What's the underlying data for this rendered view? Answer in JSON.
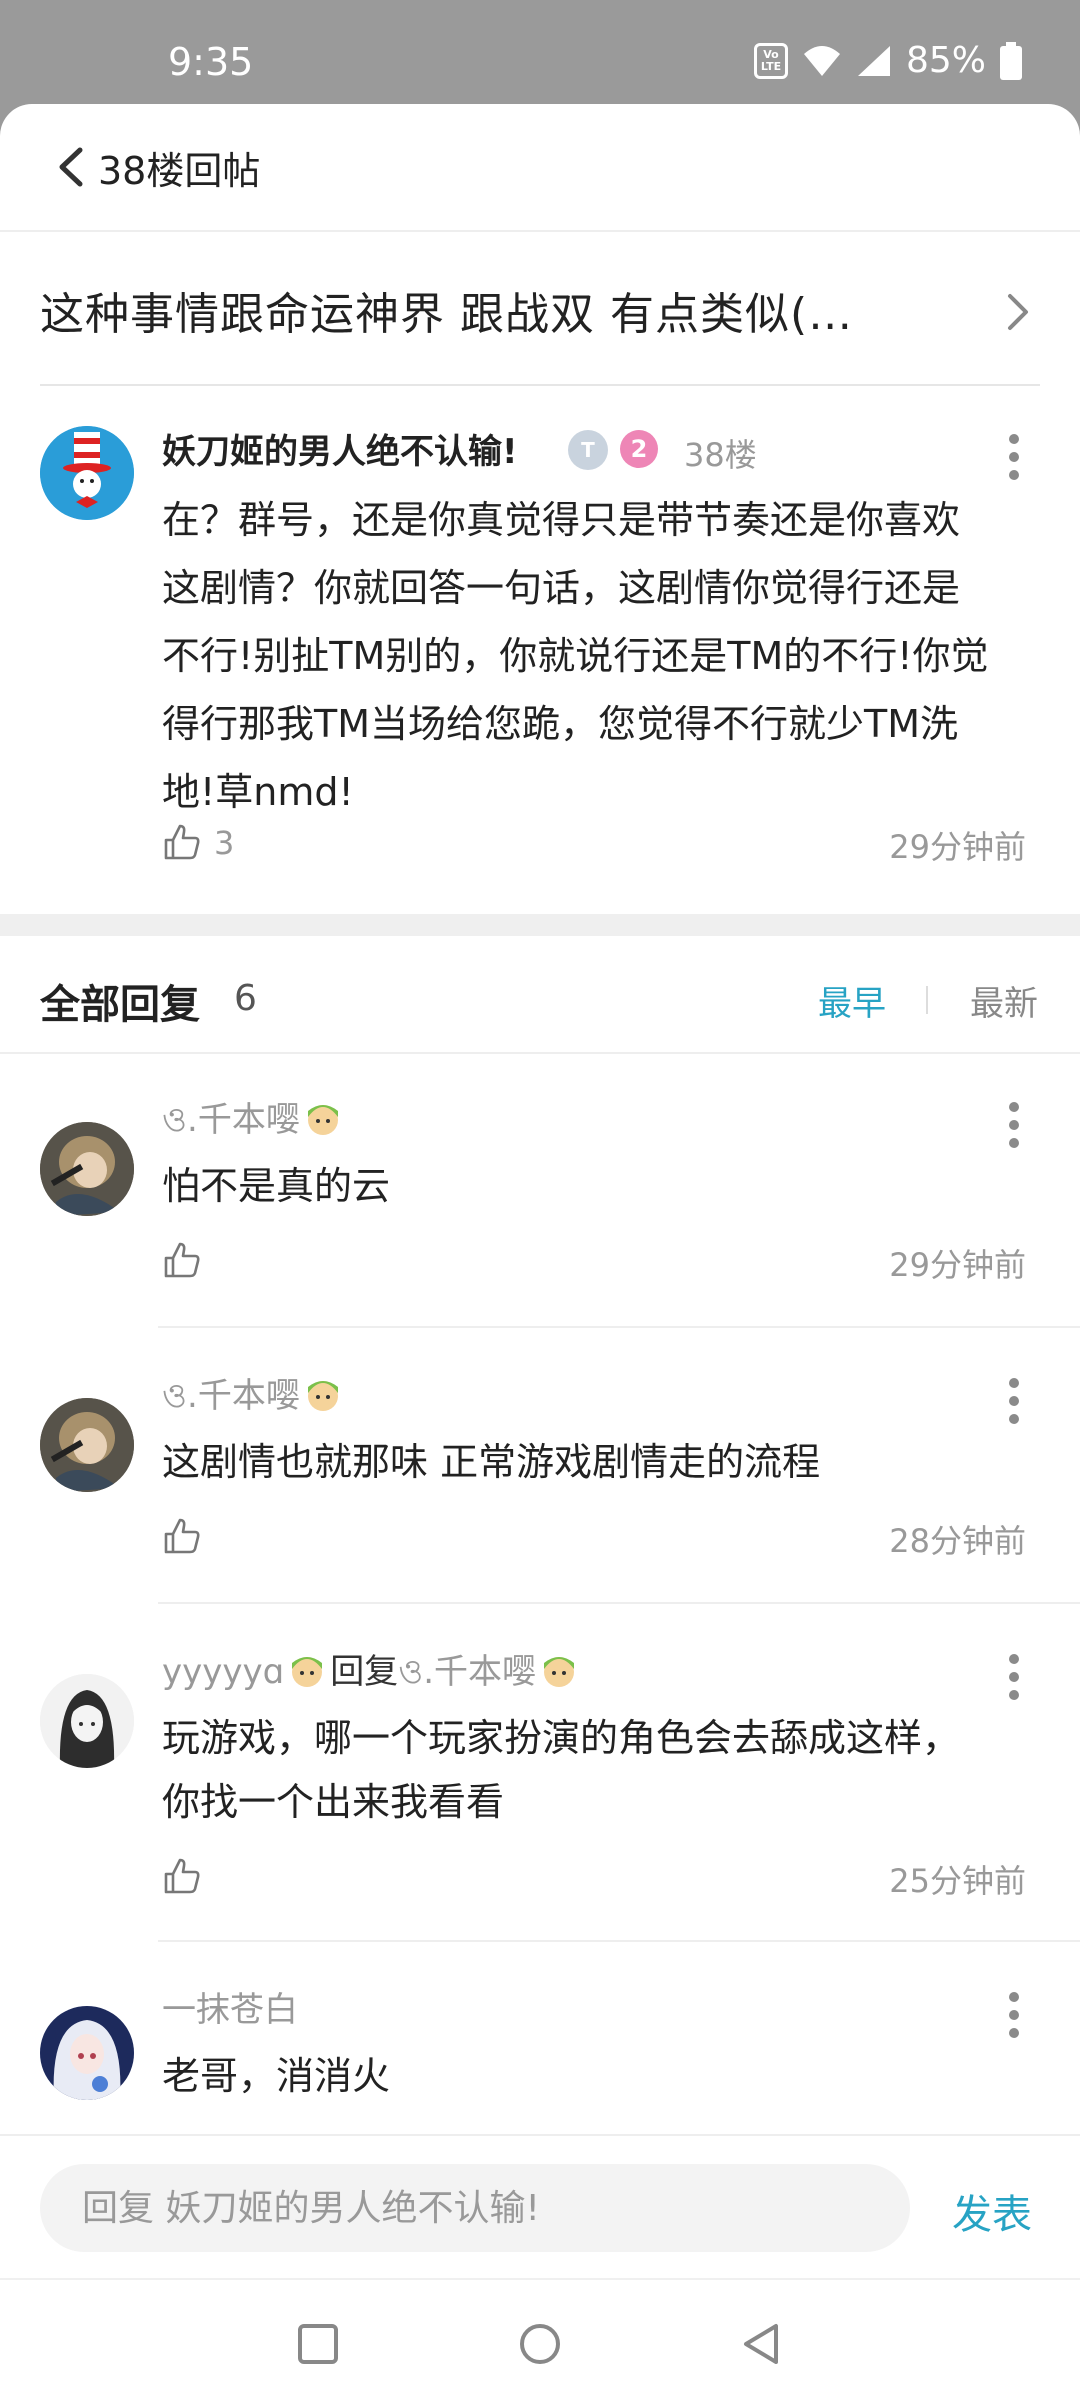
{
  "status": {
    "time": "9:35",
    "volte": "VoLTE",
    "battery": "85%"
  },
  "nav": {
    "title": "38楼回帖"
  },
  "thread": {
    "title": "这种事情跟命运神界 跟战双 有点类似(…"
  },
  "post": {
    "author": "妖刀姬的男人绝不认输!",
    "badge_t": "T",
    "badge_level": "2",
    "floor": "38楼",
    "lines": [
      "在？群号，还是你真觉得只是带节奏还是你喜欢",
      "这剧情？你就回答一句话，这剧情你觉得行还是",
      "不行!别扯TM别的，你就说行还是TM的不行!你觉",
      "得行那我TM当场给您跪，您觉得不行就少TM洗",
      "地!草nmd!"
    ],
    "likes": "3",
    "time": "29分钟前"
  },
  "replies_header": {
    "title": "全部回复",
    "count": "6",
    "sort_earliest": "最早",
    "sort_latest": "最新"
  },
  "replies": [
    {
      "author": "ও.千本嘤",
      "reply_word": "",
      "reply_to": "",
      "lines": [
        "怕不是真的云"
      ],
      "time": "29分钟前"
    },
    {
      "author": "ও.千本嘤",
      "reply_word": "",
      "reply_to": "",
      "lines": [
        "这剧情也就那味  正常游戏剧情走的流程"
      ],
      "time": "28分钟前"
    },
    {
      "author": "yyyyyɑ",
      "reply_word": "回复",
      "reply_to": "ও.千本嘤",
      "lines": [
        "玩游戏，哪一个玩家扮演的角色会去舔成这样，",
        "你找一个出来我看看"
      ],
      "time": "25分钟前"
    },
    {
      "author": "一抹苍白",
      "reply_word": "",
      "reply_to": "",
      "lines": [
        "老哥，消消火"
      ],
      "time": ""
    }
  ],
  "input": {
    "placeholder": "回复 妖刀姬的男人绝不认输!",
    "send_label": "发表"
  },
  "colors": {
    "accent": "#27a3c4",
    "status_bar": "#9a9a9a",
    "muted_text": "#999999"
  }
}
